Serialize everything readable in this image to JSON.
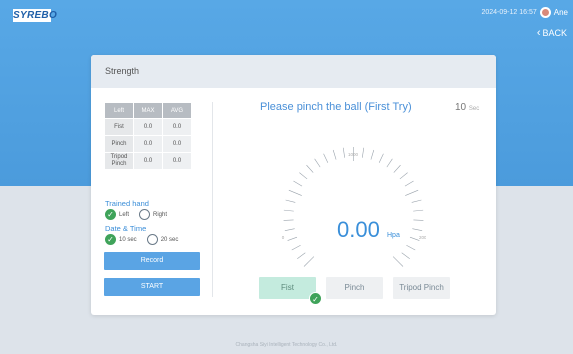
{
  "app": {
    "logo": "SYREBO"
  },
  "status_bar": {
    "datetime": "2024-09-12 16:57",
    "user": "Ane"
  },
  "nav": {
    "back_label": "BACK"
  },
  "card": {
    "title": "Strength"
  },
  "stats_table": {
    "headers": [
      "Left",
      "MAX",
      "AVG"
    ],
    "rows": [
      {
        "label": "Fist",
        "max": "0.0",
        "avg": "0.0"
      },
      {
        "label": "Pinch",
        "max": "0.0",
        "avg": "0.0"
      },
      {
        "label_line1": "Tripod",
        "label_line2": "Pinch",
        "max": "0.0",
        "avg": "0.0"
      }
    ]
  },
  "trained_hand": {
    "label": "Trained hand",
    "options": [
      "Left",
      "Right"
    ],
    "selected": "Left"
  },
  "date_time": {
    "label": "Date & Time",
    "options": [
      "10 sec",
      "20 sec"
    ],
    "selected": "10 sec"
  },
  "buttons": {
    "record": "Record",
    "start": "START"
  },
  "prompt": "Please pinch the ball (First Try)",
  "timer": {
    "value": "10",
    "unit": "Sec"
  },
  "gauge": {
    "min": "0",
    "mid": "1000",
    "max": "2000",
    "reading": "0.00",
    "unit": "Hpa"
  },
  "modes": {
    "items": [
      "Fist",
      "Pinch",
      "Tripod Pinch"
    ],
    "selected": "Fist"
  },
  "footer": "Changsha Siyi Intelligent Technology Co., Ltd.",
  "colors": {
    "accent": "#3a8fd9",
    "header_blue": "#4b9bdc",
    "check_green": "#3fa35a",
    "selected_mode": "#c4ebde"
  }
}
